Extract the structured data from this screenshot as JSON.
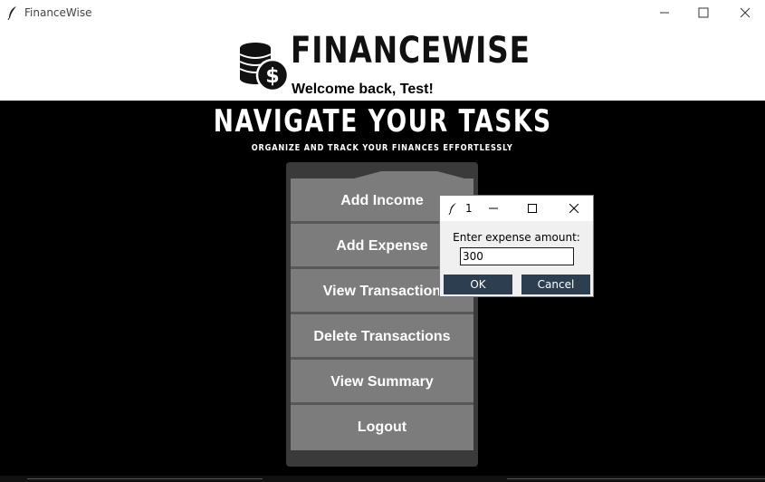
{
  "window": {
    "title": "FinanceWise",
    "icons": {
      "app": "feather-icon",
      "minimize": "minimize-icon",
      "maximize": "maximize-icon",
      "close": "close-icon"
    }
  },
  "header": {
    "brand": "FINANCEWISE",
    "logo_icon": "coin-stack-dollar-icon",
    "welcome": "Welcome back, Test!"
  },
  "main": {
    "heading": "NAVIGATE YOUR TASKS",
    "subheading": "ORGANIZE AND TRACK YOUR FINANCES EFFORTLESSLY",
    "buttons": [
      {
        "label": "Add Income"
      },
      {
        "label": "Add Expense"
      },
      {
        "label": "View Transaction"
      },
      {
        "label": "Delete Transactions"
      },
      {
        "label": "View Summary"
      },
      {
        "label": "Logout"
      }
    ]
  },
  "dialog": {
    "title": "1",
    "prompt": "Enter expense amount:",
    "value": "300",
    "ok_label": "OK",
    "cancel_label": "Cancel"
  },
  "colors": {
    "background": "#000000",
    "button": "#7c7c7c",
    "panel": "#3a3a3a",
    "dialog_button": "#2d3e50"
  }
}
